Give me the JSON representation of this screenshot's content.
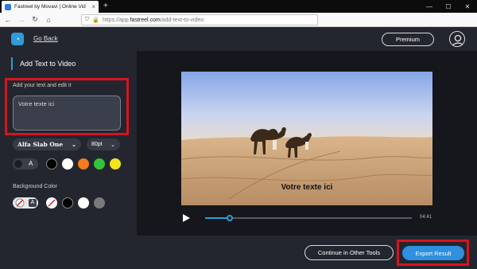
{
  "browser": {
    "tab_title": "Fastreel by Movavi | Online Vid",
    "url_prefix": "https://app.",
    "url_domain": "fastreel.com",
    "url_path": "/add-text-to-video"
  },
  "header": {
    "go_back": "Go Back",
    "premium": "Premium"
  },
  "sidebar": {
    "title": "Add Text to Video",
    "text_label": "Add your text and edit it",
    "text_value": "Votre texte ici",
    "font_name": "Alfa Slab One",
    "font_size": "80pt",
    "text_color_toggle": "A",
    "text_colors": [
      "#000000",
      "#ffffff",
      "#f47b20",
      "#34c23a",
      "#f3e51d"
    ],
    "background_label": "Background Color",
    "bg_toggle": "A",
    "bg_colors": [
      "#000000",
      "#ffffff",
      "#7a7a7a"
    ]
  },
  "video": {
    "caption": "Votre texte ici",
    "time": "04:41",
    "progress": 0.12
  },
  "footer": {
    "continue": "Continue in Other Tools",
    "export": "Export Result"
  },
  "colors": {
    "accent": "#2f9bd8",
    "highlight": "#d7131f"
  }
}
